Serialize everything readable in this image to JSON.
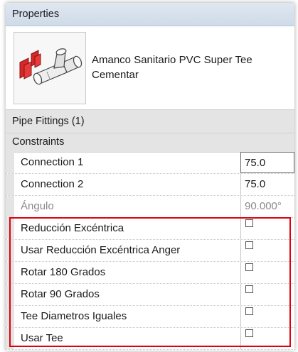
{
  "title": "Properties",
  "type_selector": {
    "name": "Amanco Sanitario PVC Super Tee Cementar",
    "thumbnail_icon": "pipe-tee-fitting-icon"
  },
  "sections": {
    "category": "Pipe Fittings (1)",
    "constraints": "Constraints"
  },
  "parameters": [
    {
      "label": "Connection 1",
      "value": "75.0"
    },
    {
      "label": "Connection 2",
      "value": "75.0"
    },
    {
      "label": "Ángulo",
      "value": "90.000°"
    }
  ],
  "checkbox_parameters": [
    {
      "label": "Reducción Excéntrica",
      "checked": false
    },
    {
      "label": "Usar Reducción Excéntrica Anger",
      "checked": false
    },
    {
      "label": "Rotar 180 Grados",
      "checked": false
    },
    {
      "label": "Rotar 90 Grados",
      "checked": false
    },
    {
      "label": "Tee Diametros Iguales",
      "checked": false
    },
    {
      "label": "Usar Tee",
      "checked": false
    }
  ],
  "colors": {
    "title_bar": "#cfdbe9",
    "section_header": "#e4e4e4",
    "highlight": "#e0000f"
  }
}
